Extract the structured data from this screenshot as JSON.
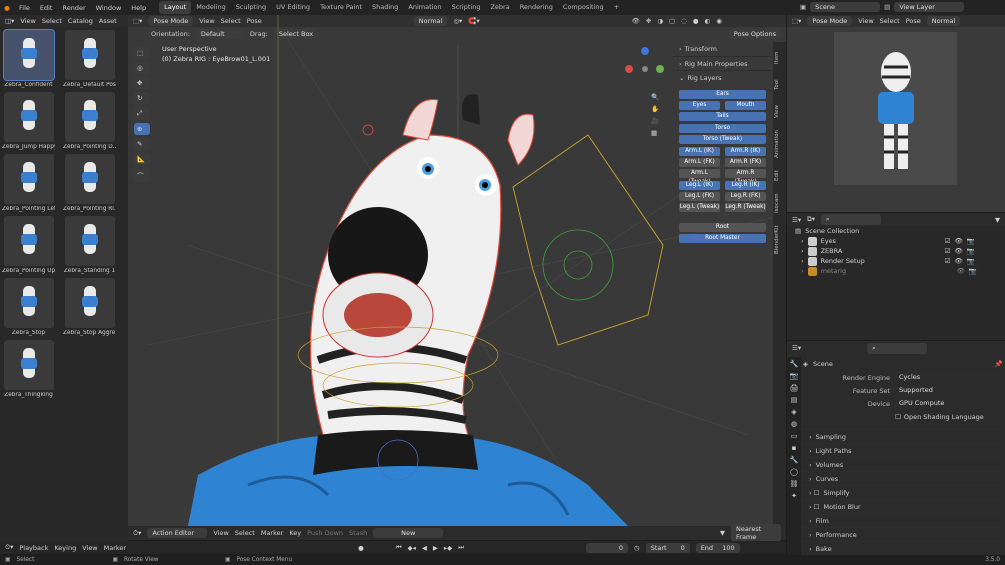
{
  "top_menu": [
    "File",
    "Edit",
    "Render",
    "Window",
    "Help"
  ],
  "workspaces": [
    {
      "label": "Layout",
      "active": true
    },
    {
      "label": "Modeling"
    },
    {
      "label": "Sculpting"
    },
    {
      "label": "UV Editing"
    },
    {
      "label": "Texture Paint"
    },
    {
      "label": "Shading"
    },
    {
      "label": "Animation"
    },
    {
      "label": "Scripting"
    },
    {
      "label": "Zebra"
    },
    {
      "label": "Rendering"
    },
    {
      "label": "Compositing"
    }
  ],
  "scene_field": "Scene",
  "view_layer_field": "View Layer",
  "asset_browser": {
    "menus": [
      "View",
      "Select",
      "Catalog",
      "Asset"
    ],
    "assets": [
      "Zebra_Confident",
      "Zebra_Default Pose",
      "Zebra_Jump Happy",
      "Zebra_Pointing D...",
      "Zebra_Pointing Left",
      "Zebra_Pointing Ri...",
      "Zebra_Pointing Up",
      "Zebra_Standing 1",
      "Zebra_Stop",
      "Zebra_Stop Aggre...",
      "Zebra_Thingking"
    ]
  },
  "viewport": {
    "mode": "Pose Mode",
    "menus": [
      "View",
      "Select",
      "Pose"
    ],
    "shading": "Normal",
    "orientation_label": "Orientation:",
    "orientation_value": "Default",
    "drag_label": "Drag:",
    "drag_value": "Select Box",
    "pose_options": "Pose Options",
    "overlay_title": "User Perspective",
    "overlay_sub": "(0) Zebra RIG : EyeBrow01_L.001"
  },
  "npanel": {
    "sections": [
      "Transform",
      "Rig Main Properties",
      "Rig Layers"
    ],
    "tabs": [
      "Item",
      "Tool",
      "View",
      "Animation",
      "Edit",
      "Isocam",
      "BlenderKit"
    ],
    "layers": {
      "ears": "Ears",
      "eyes": "Eyes",
      "mouth": "Mouth",
      "tails": "Tails",
      "torso": "Torso",
      "torso_tweak": "Torso (Tweak)",
      "arm_l_ik": "Arm.L (IK)",
      "arm_r_ik": "Arm.R (IK)",
      "arm_l_fk": "Arm.L (FK)",
      "arm_r_fk": "Arm.R (FK)",
      "arm_l_tw": "Arm.L (Tweak)",
      "arm_r_tw": "Arm.R (Tweak)",
      "leg_l_ik": "Leg.L (IK)",
      "leg_r_ik": "Leg.R (IK)",
      "leg_l_fk": "Leg.L (FK)",
      "leg_r_fk": "Leg.R (FK)",
      "leg_l_tw": "Leg.L (Tweak)",
      "leg_r_tw": "Leg.R (Tweak)",
      "root": "Root",
      "root_master": "Root Master"
    }
  },
  "action_editor": {
    "mode": "Action Editor",
    "menus": [
      "View",
      "Select",
      "Marker",
      "Key"
    ],
    "push_down": "Push Down",
    "stash": "Stash",
    "new_label": "New",
    "snap": "Nearest Frame"
  },
  "timeline": {
    "menus": [
      "Playback",
      "Keying",
      "View",
      "Marker"
    ],
    "current_frame": "0",
    "start_label": "Start",
    "start": "0",
    "end_label": "End",
    "end": "100"
  },
  "status_bar": {
    "select": "Select",
    "rotate": "Rotate View",
    "context": "Pose Context Menu",
    "version": "3.5.0"
  },
  "preview": {
    "mode": "Pose Mode",
    "menus": [
      "View",
      "Select",
      "Pose"
    ],
    "shading": "Normal"
  },
  "outliner": {
    "root": "Scene Collection",
    "items": [
      {
        "label": "Eyes"
      },
      {
        "label": "ZEBRA"
      },
      {
        "label": "Render Setup"
      },
      {
        "label": "metarig"
      }
    ]
  },
  "properties": {
    "scene": "Scene",
    "render_engine_label": "Render Engine",
    "render_engine": "Cycles",
    "feature_set_label": "Feature Set",
    "feature_set": "Supported",
    "device_label": "Device",
    "device": "GPU Compute",
    "osl": "Open Shading Language",
    "sections": [
      "Sampling",
      "Light Paths",
      "Volumes",
      "Curves",
      "Simplify",
      "Motion Blur",
      "Film",
      "Performance",
      "Bake"
    ]
  }
}
